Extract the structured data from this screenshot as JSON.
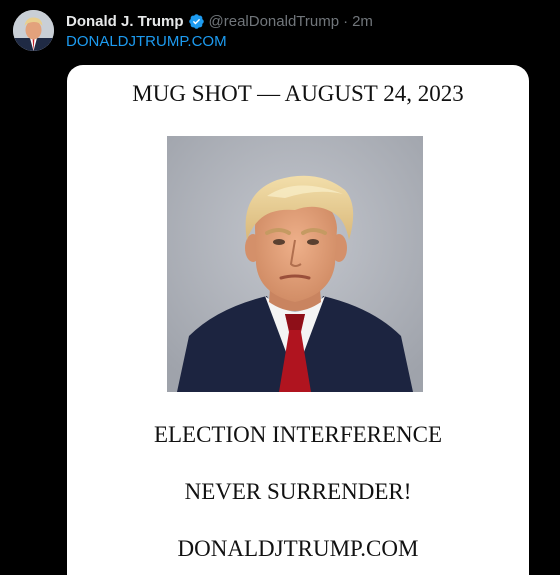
{
  "tweet": {
    "display_name": "Donald J. Trump",
    "handle": "@realDonaldTrump",
    "separator": "·",
    "timestamp": "2m",
    "link_text": "DONALDJTRUMP.COM",
    "verified_icon": "verified-badge-icon",
    "accent_color": "#1d9bf0"
  },
  "image": {
    "title": "MUG SHOT — AUGUST 24, 2023",
    "line_1": "ELECTION INTERFERENCE",
    "line_2": "NEVER SURRENDER!",
    "line_3": "DONALDJTRUMP.COM"
  },
  "colors": {
    "background": "#000000",
    "name_text": "#e7e9ea",
    "meta_text": "#71767b",
    "card_background": "#ffffff"
  }
}
